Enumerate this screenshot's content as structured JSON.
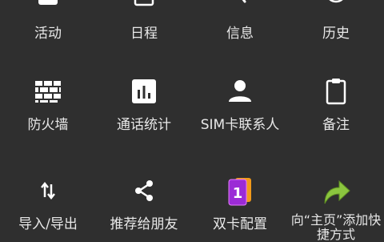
{
  "grid": {
    "row1": [
      {
        "label": "活动",
        "icon": "activity-icon"
      },
      {
        "label": "日程",
        "icon": "calendar-icon"
      },
      {
        "label": "信息",
        "icon": "message-icon"
      },
      {
        "label": "历史",
        "icon": "history-icon"
      }
    ],
    "row2": [
      {
        "label": "防火墙",
        "icon": "firewall-icon"
      },
      {
        "label": "通话统计",
        "icon": "bar-chart-icon"
      },
      {
        "label": "SIM卡联系人",
        "icon": "person-icon"
      },
      {
        "label": "备注",
        "icon": "clipboard-icon"
      }
    ],
    "row3": [
      {
        "label": "导入/导出",
        "icon": "import-export-icon"
      },
      {
        "label": "推荐给朋友",
        "icon": "share-icon"
      },
      {
        "label": "双卡配置",
        "icon": "dual-sim-icon"
      },
      {
        "label": "向“主页”添加快捷方式",
        "icon": "shortcut-arrow-icon"
      }
    ]
  },
  "colors": {
    "background": "#2f2f2f",
    "icon": "#ffffff",
    "text": "#e8e8e8",
    "dual_sim_purple": "#9b2bd6",
    "dual_sim_orange": "#f29a1a",
    "arrow_green": "#8bc53f"
  }
}
